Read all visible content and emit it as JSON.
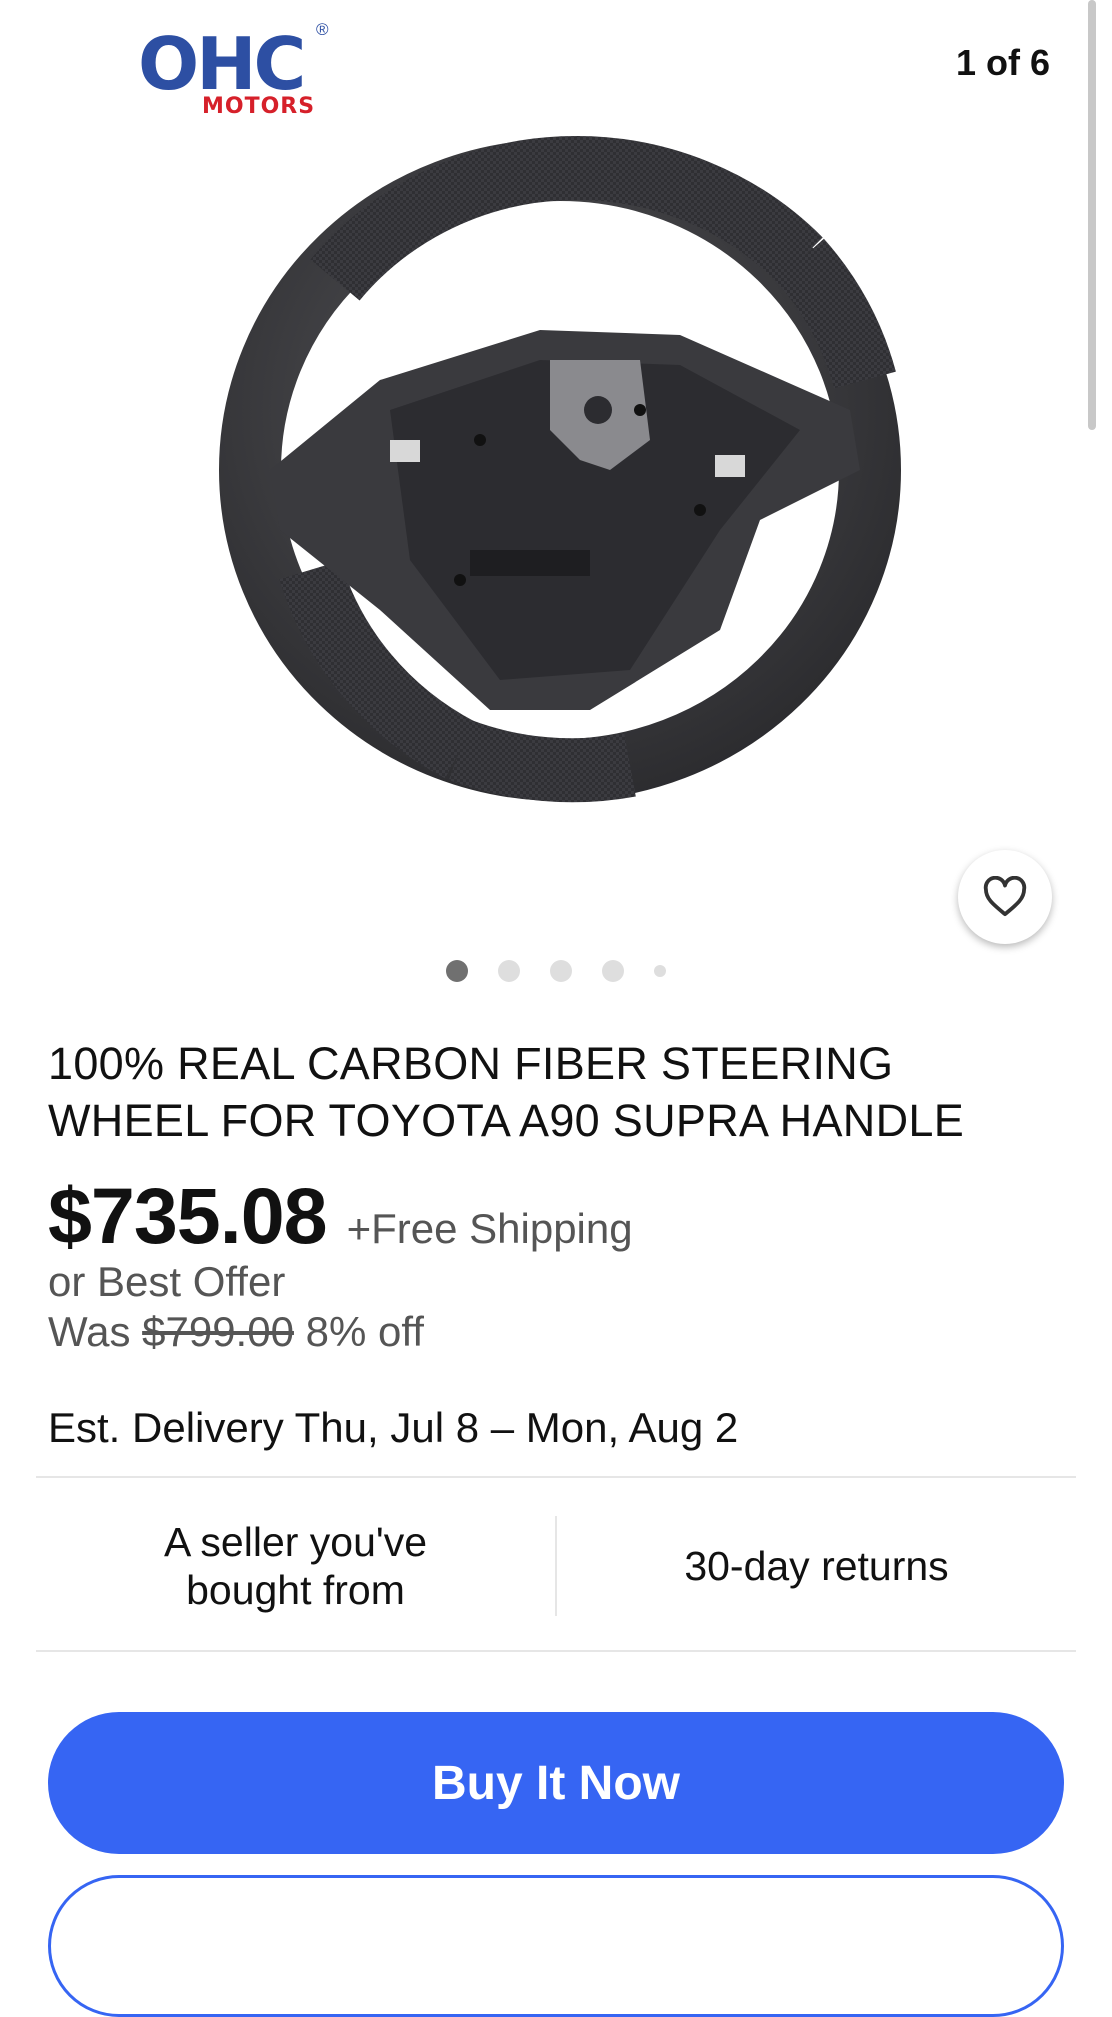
{
  "gallery": {
    "logo": {
      "main": "OHC",
      "sub": "MOTORS",
      "reg": "®"
    },
    "counter": "1 of 6",
    "image_alt": "Carbon fiber steering wheel",
    "dots_count": 5,
    "active_dot": 0,
    "favorite_icon": "heart-icon"
  },
  "listing": {
    "title": "100% REAL CARBON FIBER STEERING WHEEL FOR TOYOTA A90 SUPRA HANDLE",
    "price": "$735.08",
    "shipping": "+Free Shipping",
    "best_offer": "or Best Offer",
    "was_label": "Was",
    "was_price": "$799.00",
    "discount": "8% off",
    "delivery_label": "Est. Delivery",
    "delivery_dates": "Thu, Jul 8 – Mon, Aug 2"
  },
  "info": {
    "seller_line1": "A seller you've",
    "seller_line2": "bought from",
    "returns": "30-day returns"
  },
  "actions": {
    "buy_now": "Buy It Now"
  },
  "colors": {
    "accent": "#3665f3",
    "logo_blue": "#2d4fa3",
    "logo_red": "#d6202a",
    "text_secondary": "#555555"
  }
}
